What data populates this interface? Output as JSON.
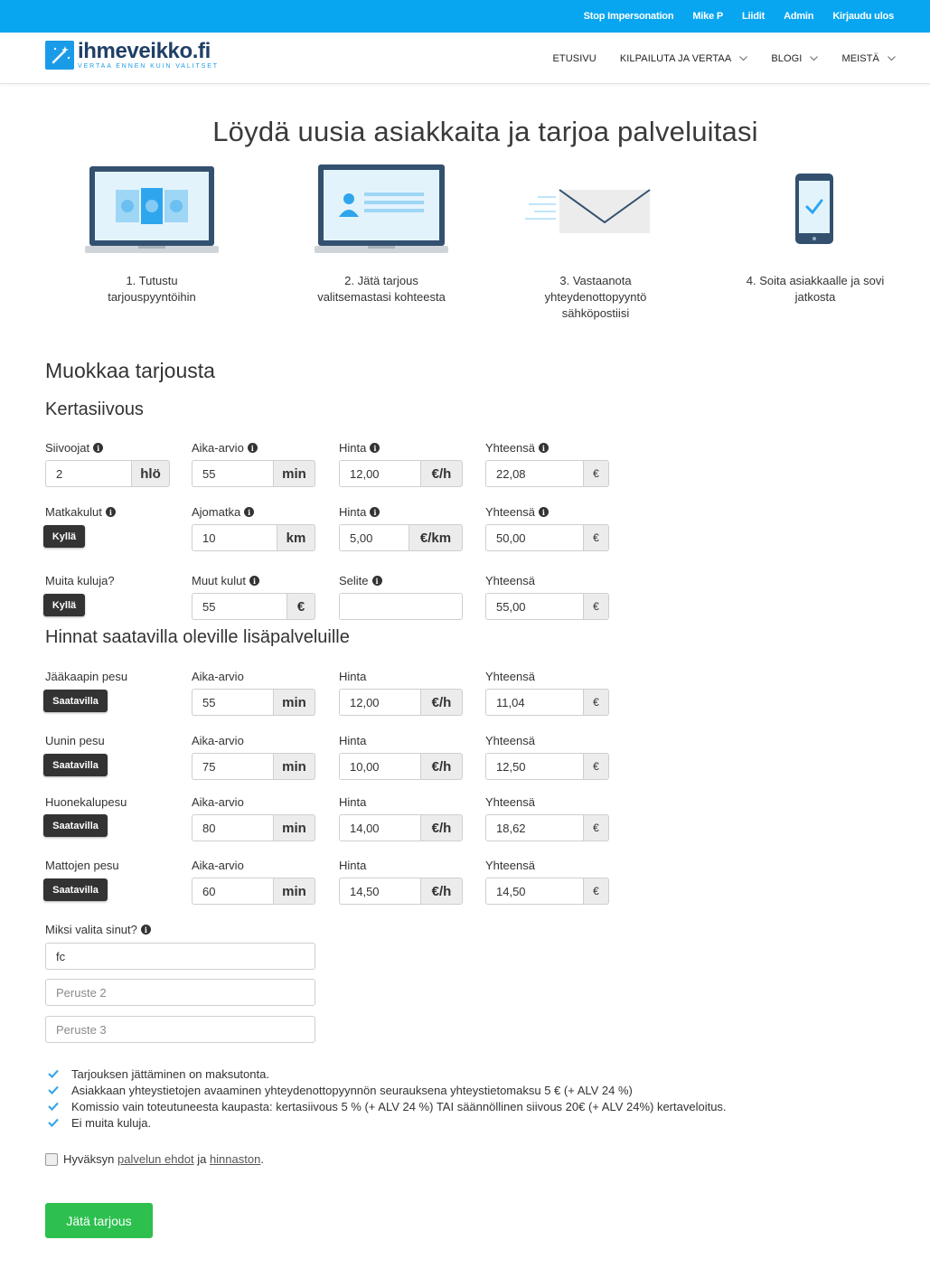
{
  "topbar": {
    "links": [
      "Stop Impersonation",
      "Mike P",
      "Liidit",
      "Admin",
      "Kirjaudu ulos"
    ]
  },
  "header": {
    "logo_name": "ihmeveikko.fi",
    "logo_tagline": "VERTAA ENNEN KUIN VALITSET",
    "nav": [
      {
        "label": "ETUSIVU",
        "dropdown": false
      },
      {
        "label": "KILPAILUTA JA VERTAA",
        "dropdown": true
      },
      {
        "label": "BLOGI",
        "dropdown": true
      },
      {
        "label": "MEISTÄ",
        "dropdown": true
      }
    ]
  },
  "hero": {
    "title": "Löydä uusia asiakkaita ja tarjoa palveluitasi",
    "steps": [
      {
        "line1": "1. Tutustu",
        "line2": "tarjouspyyntöihin",
        "line3": "",
        "icon": "laptop-euro-icon"
      },
      {
        "line1": "2. Jätä tarjous",
        "line2": "valitsemastasi kohteesta",
        "line3": "",
        "icon": "laptop-profile-icon"
      },
      {
        "line1": "3. Vastaanota",
        "line2": "yhteydenottopyyntö",
        "line3": "sähköpostiisi",
        "icon": "envelope-icon"
      },
      {
        "line1": "4. Soita asiakkaalle ja sovi",
        "line2": "jatkosta",
        "line3": "",
        "icon": "phone-check-icon"
      }
    ]
  },
  "form": {
    "title": "Muokkaa tarjousta",
    "service_title": "Kertasiivous",
    "row1": {
      "l1": "Siivoojat",
      "v1": "2",
      "u1": "hlö",
      "l2": "Aika-arvio",
      "v2": "55",
      "u2": "min",
      "l3": "Hinta",
      "v3": "12,00",
      "u3": "€/h",
      "l4": "Yhteensä",
      "v4": "22,08",
      "u4": "€"
    },
    "row2": {
      "l1": "Matkakulut",
      "btn": "Kyllä",
      "l2": "Ajomatka",
      "v2": "10",
      "u2": "km",
      "l3": "Hinta",
      "v3": "5,00",
      "u3": "€/km",
      "l4": "Yhteensä",
      "v4": "50,00",
      "u4": "€"
    },
    "row3": {
      "l1": "Muita kuluja?",
      "btn": "Kyllä",
      "l2": "Muut kulut",
      "v2": "55",
      "u2": "€",
      "l3": "Selite",
      "v3": "",
      "l4": "Yhteensä",
      "v4": "55,00",
      "u4": "€"
    },
    "extras_title": "Hinnat saatavilla oleville lisäpalveluille",
    "extras": [
      {
        "name": "Jääkaapin pesu",
        "btn": "Saatavilla",
        "time_label": "Aika-arvio",
        "time": "55",
        "time_unit": "min",
        "price_label": "Hinta",
        "price": "12,00",
        "price_unit": "€/h",
        "total_label": "Yhteensä",
        "total": "11,04",
        "total_unit": "€"
      },
      {
        "name": "Uunin pesu",
        "btn": "Saatavilla",
        "time_label": "Aika-arvio",
        "time": "75",
        "time_unit": "min",
        "price_label": "Hinta",
        "price": "10,00",
        "price_unit": "€/h",
        "total_label": "Yhteensä",
        "total": "12,50",
        "total_unit": "€"
      },
      {
        "name": "Huonekalupesu",
        "btn": "Saatavilla",
        "time_label": "Aika-arvio",
        "time": "80",
        "time_unit": "min",
        "price_label": "Hinta",
        "price": "14,00",
        "price_unit": "€/h",
        "total_label": "Yhteensä",
        "total": "18,62",
        "total_unit": "€"
      },
      {
        "name": "Mattojen pesu",
        "btn": "Saatavilla",
        "time_label": "Aika-arvio",
        "time": "60",
        "time_unit": "min",
        "price_label": "Hinta",
        "price": "14,50",
        "price_unit": "€/h",
        "total_label": "Yhteensä",
        "total": "14,50",
        "total_unit": "€"
      }
    ],
    "why_label": "Miksi valita sinut?",
    "reasons": [
      {
        "value": "fc",
        "placeholder": ""
      },
      {
        "value": "",
        "placeholder": "Peruste 2"
      },
      {
        "value": "",
        "placeholder": "Peruste 3"
      }
    ],
    "checklist": [
      "Tarjouksen jättäminen on maksutonta.",
      "Asiakkaan yhteystietojen avaaminen yhteydenottopyynnön seurauksena yhteystietomaksu 5 € (+ ALV 24 %)",
      "Komissio vain toteutuneesta kaupasta: kertasiivous 5 % (+ ALV 24 %) TAI säännöllinen siivous 20€ (+ ALV 24%) kertaveloitus.",
      "Ei muita kuluja."
    ],
    "agree": {
      "pre": "Hyväksyn",
      "link1": "palvelun ehdot",
      "mid": "ja",
      "link2": "hinnaston",
      "post": "."
    },
    "submit_label": "Jätä tarjous"
  },
  "colors": {
    "topbar": "#08a6f0",
    "brand_dark": "#1f3f66",
    "brand_blue": "#1a9be8",
    "submit": "#2dc04f",
    "dark_button": "#333333",
    "check": "#3aa7e8"
  }
}
